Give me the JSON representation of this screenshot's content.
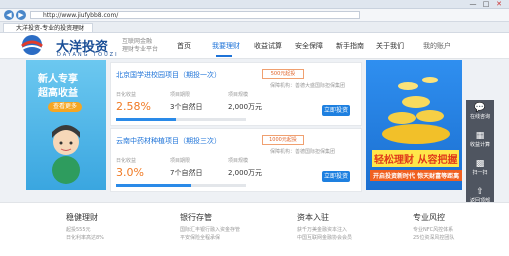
{
  "browser": {
    "url": "http://www.jiufybb8.com/",
    "tab_title": "大洋投资-专业的投资理财",
    "controls": [
      "—",
      "□",
      "✕"
    ]
  },
  "site": {
    "brand_cn": "大洋投资",
    "brand_en": "DAYANG TOUZI",
    "slogan_line1": "互联网金融",
    "slogan_line2": "理财专业平台",
    "nav": [
      "首页",
      "我要理财",
      "收益试算",
      "安全保障",
      "新手指南",
      "关于我们"
    ],
    "account": "我的账户"
  },
  "promo_left": {
    "line1": "新人专享",
    "line2": "超高收益",
    "button": "查看更多"
  },
  "products": [
    {
      "title": "北京国学进校园项目（期投一次）",
      "badge": "500元起投",
      "guarantee": "保障机构：善德大盛国际担保集团",
      "rate_label": "日化收益",
      "term_label": "项目期限",
      "scale_label": "项目规模",
      "rate": "2.58%",
      "term": "3个自然日",
      "scale": "2,000万元",
      "button": "立即投资",
      "progress": 0.46
    },
    {
      "title": "云南中药材种植项目（期投三次）",
      "badge": "1000元起投",
      "guarantee": "保障机构：善德国际担保集团",
      "rate_label": "日化收益",
      "term_label": "项目期限",
      "scale_label": "项目规模",
      "rate": "3.0%",
      "term": "7个自然日",
      "scale": "2,000万元",
      "button": "立即投资",
      "progress": 0.58
    }
  ],
  "promo_right": {
    "headline": "轻松理财 从容把握",
    "subline": "开启投资新时代 惊天财富等距离"
  },
  "sidebar": [
    {
      "icon": "💬",
      "label": "在线咨询"
    },
    {
      "icon": "▦",
      "label": "收益计算"
    },
    {
      "icon": "▩",
      "label": "扫一扫"
    },
    {
      "icon": "⇧",
      "label": "返回顶部"
    }
  ],
  "features": [
    {
      "title": "稳健理财",
      "desc1": "起投555元",
      "desc2": "日化利率高达8%"
    },
    {
      "title": "银行存管",
      "desc1": "国际汇丰银行融入资金存管",
      "desc2": "平安保险全程承保"
    },
    {
      "title": "资本入驻",
      "desc1": "获千万美金融资本注入",
      "desc2": "中国互联网金融协会会员"
    },
    {
      "title": "专业风控",
      "desc1": "专业NFC风控体系",
      "desc2": "25位资深风控团队"
    }
  ]
}
